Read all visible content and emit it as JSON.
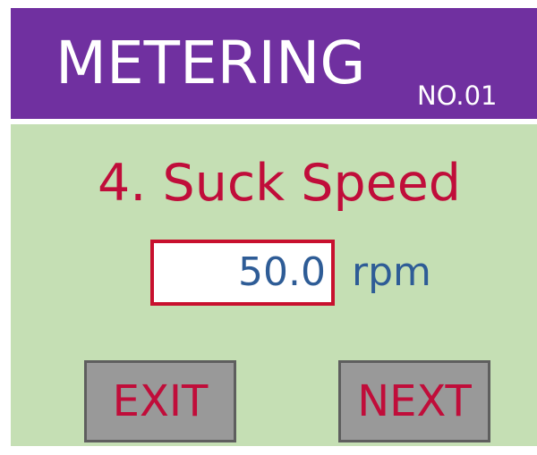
{
  "header": {
    "title": "METERING",
    "machine_no": "NO.01"
  },
  "step": {
    "title": "4. Suck Speed"
  },
  "setting": {
    "value": "50.0",
    "unit": "rpm"
  },
  "buttons": {
    "exit_label": "EXIT",
    "next_label": "NEXT"
  },
  "colors": {
    "header_bg": "#7030a0",
    "panel_bg": "#c5dfb4",
    "accent_red": "#c00d3a",
    "value_blue": "#2e5c96",
    "button_gray": "#999999"
  }
}
